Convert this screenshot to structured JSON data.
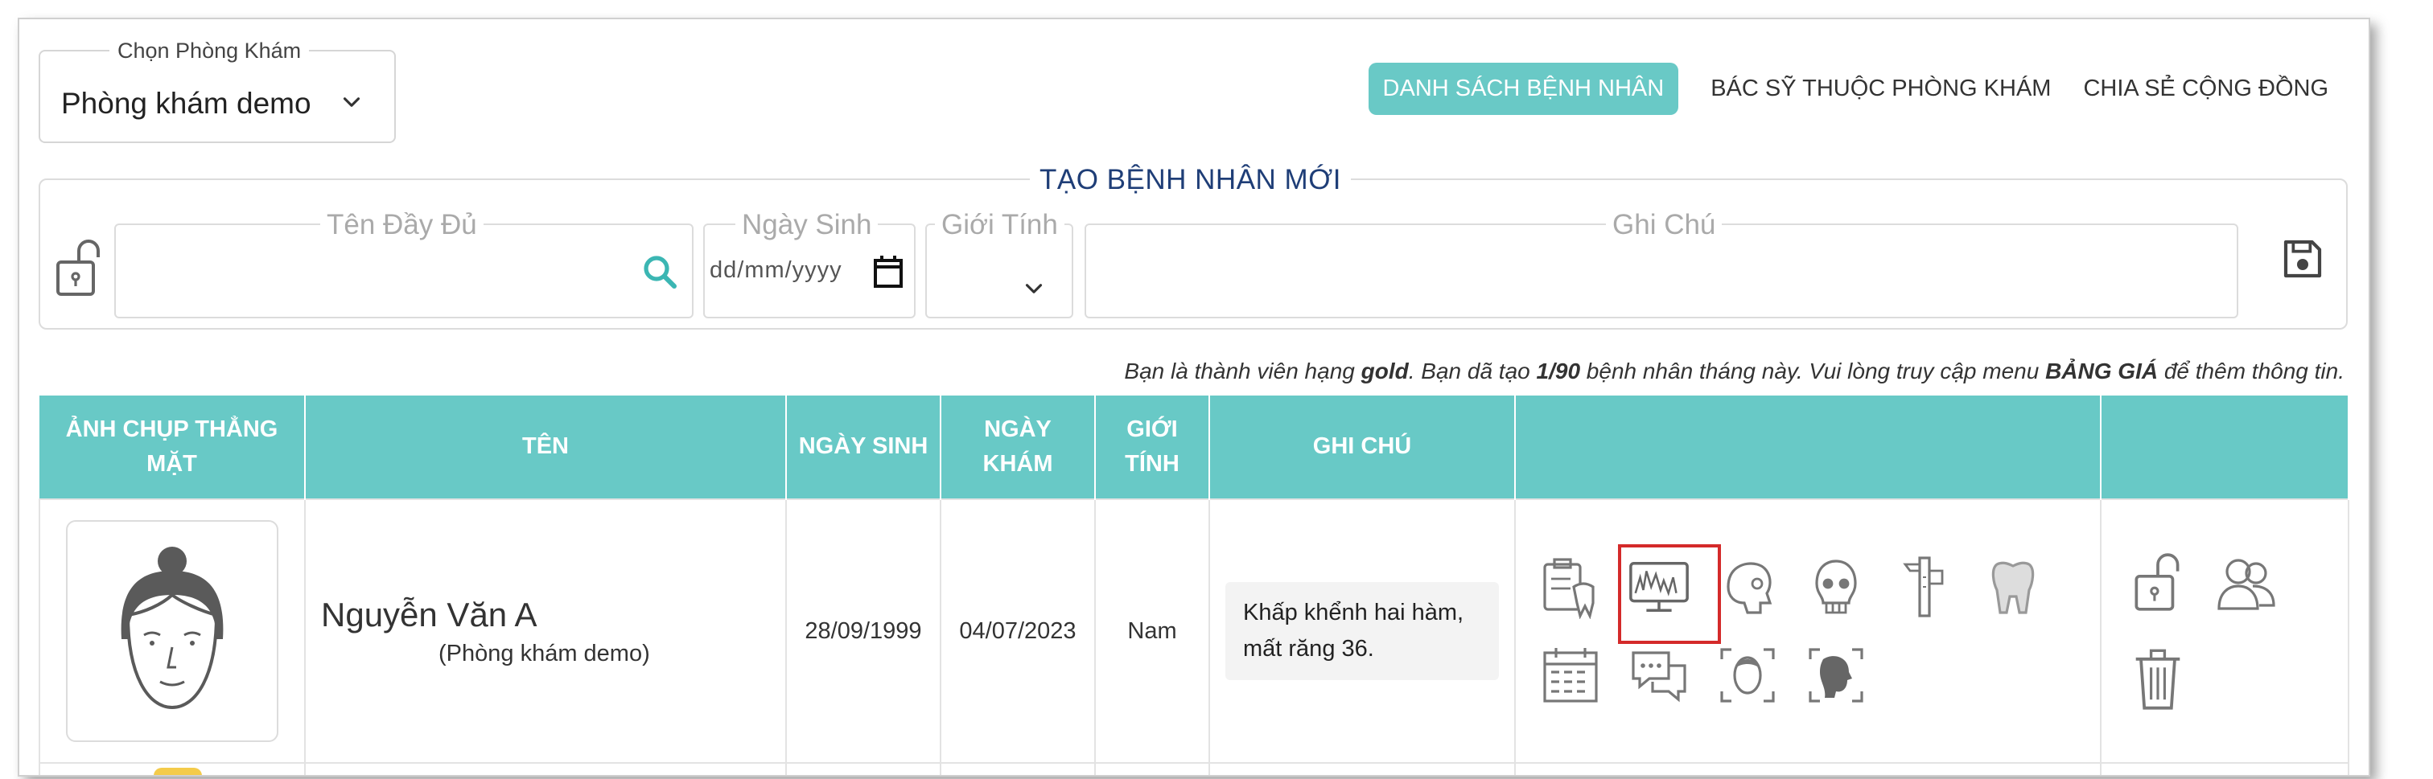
{
  "clinic_select": {
    "legend": "Chọn Phòng Khám",
    "value": "Phòng khám demo"
  },
  "tabs": [
    {
      "label": "DANH SÁCH BỆNH NHÂN",
      "active": true
    },
    {
      "label": "BÁC SỸ THUỘC PHÒNG KHÁM",
      "active": false
    },
    {
      "label": "CHIA SẺ CỘNG ĐỒNG",
      "active": false
    }
  ],
  "new_patient": {
    "title": "TẠO BỆNH NHÂN MỚI",
    "full_name_label": "Tên Đầy Đủ",
    "dob_label": "Ngày Sinh",
    "dob_placeholder": "dd/mm/yyyy",
    "gender_label": "Giới Tính",
    "notes_label": "Ghi Chú"
  },
  "notice": {
    "p1": "Bạn là thành viên hạng ",
    "tier": "gold",
    "p2": ".  Bạn dã tạo ",
    "quota": "1/90",
    "p3": " bệnh nhân tháng này.  Vui lòng truy cập menu ",
    "menu": "BẢNG GIÁ",
    "p4": " để thêm thông tin."
  },
  "table": {
    "headers": {
      "photo": "ẢNH CHỤP THẲNG MẶT",
      "name": "TÊN",
      "dob": "NGÀY SINH",
      "visit": "NGÀY KHÁM",
      "gender": "GIỚI TÍNH",
      "notes": "GHI CHÚ",
      "tools": "",
      "actions": ""
    },
    "rows": [
      {
        "name": "Nguyễn Văn A",
        "clinic": "(Phòng khám demo)",
        "dob": "28/09/1999",
        "visit_date": "04/07/2023",
        "gender": "Nam",
        "notes": "Khấp khểnh hai hàm, mất răng 36."
      }
    ]
  },
  "icons": {
    "tools": [
      "clipboard-tooth-icon",
      "xray-monitor-icon",
      "skull-profile-icon",
      "skull-front-icon",
      "caliper-icon",
      "tooth-xray-icon",
      "calendar-icon",
      "chat-icon",
      "face-front-scan-icon",
      "face-profile-scan-icon"
    ],
    "actions": [
      "unlock-icon",
      "share-users-icon",
      "trash-icon"
    ]
  },
  "colors": {
    "teal": "#68c9c6",
    "title_navy": "#1f3e77",
    "highlight_red": "#d42a2a"
  }
}
